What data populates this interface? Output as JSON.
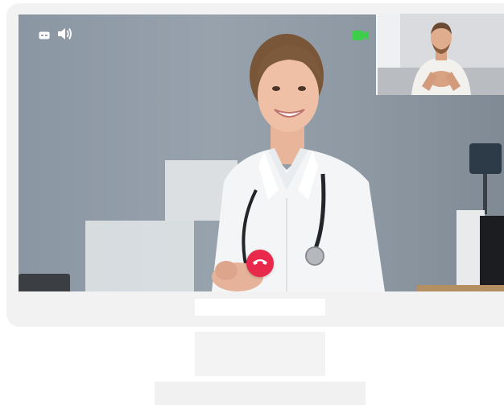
{
  "call": {
    "controls": {
      "captions_icon": "captions-icon",
      "speaker_icon": "speaker-icon",
      "camera_icon": "video-camera-icon",
      "end_call_icon": "hang-up-phone-icon"
    },
    "status_text": "",
    "colors": {
      "bezel": "#f2f2f2",
      "end_call": "#e8294b",
      "camera_active": "#3ecf4a",
      "controls": "#ffffff"
    }
  }
}
